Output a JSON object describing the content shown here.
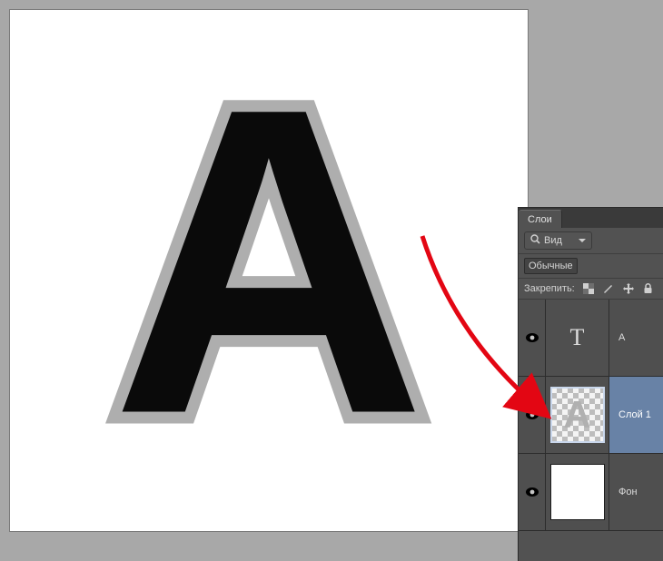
{
  "colors": {
    "workspace_bg": "#a8a8a8",
    "canvas_bg": "#ffffff",
    "letter_main": "#0a0a0a",
    "letter_outline": "#aeaeae",
    "panel_bg": "#525252",
    "panel_dark": "#3a3a3a",
    "row_selected": "#6882a6",
    "arrow": "#e30613"
  },
  "canvas": {
    "letter": "A"
  },
  "panel": {
    "tab_label": "Слои",
    "view_button_label": "Вид",
    "filter_label": "Обычные",
    "lock_label": "Закрепить:"
  },
  "layers": [
    {
      "name": "A",
      "type": "text",
      "thumb_glyph": "T",
      "visible": true,
      "selected": false
    },
    {
      "name": "Слой 1",
      "type": "raster",
      "thumb_glyph": "A",
      "visible": true,
      "selected": true
    },
    {
      "name": "Фон",
      "type": "background",
      "thumb_glyph": "",
      "visible": true,
      "selected": false
    }
  ]
}
